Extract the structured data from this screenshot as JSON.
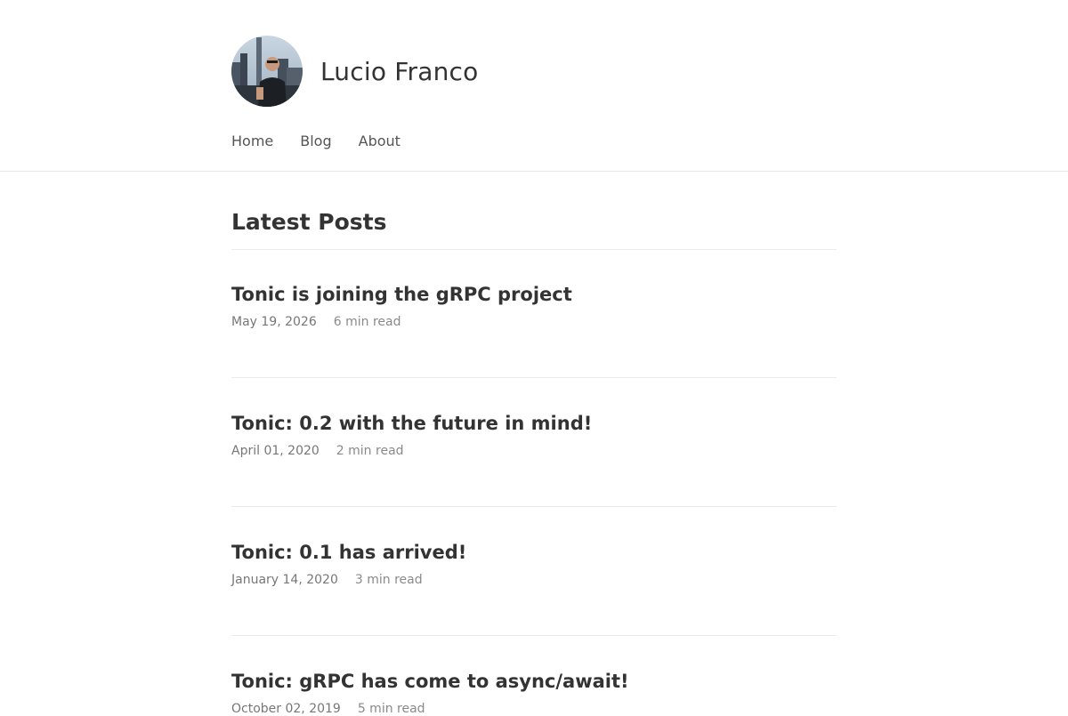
{
  "site": {
    "title": "Lucio Franco"
  },
  "nav": {
    "items": [
      {
        "label": "Home"
      },
      {
        "label": "Blog"
      },
      {
        "label": "About"
      }
    ]
  },
  "main": {
    "section_title": "Latest Posts",
    "posts": [
      {
        "title": "Tonic is joining the gRPC project",
        "date": "May 19, 2026",
        "read_time": "6 min read"
      },
      {
        "title": "Tonic: 0.2 with the future in mind!",
        "date": "April 01, 2020",
        "read_time": "2 min read"
      },
      {
        "title": "Tonic: 0.1 has arrived!",
        "date": "January 14, 2020",
        "read_time": "3 min read"
      },
      {
        "title": "Tonic: gRPC has come to async/await!",
        "date": "October 02, 2019",
        "read_time": "5 min read"
      }
    ]
  }
}
